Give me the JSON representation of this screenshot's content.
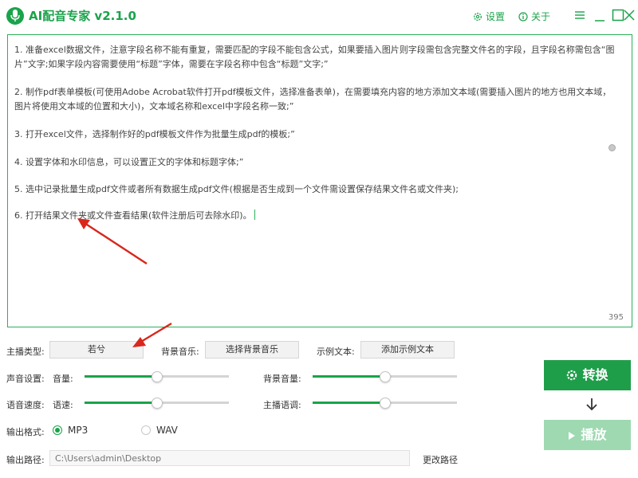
{
  "app": {
    "title": "AI配音专家 v2.1.0",
    "settings_label": "设置",
    "about_label": "关于"
  },
  "editor": {
    "lines": [
      "1. 准备excel数据文件，注意字段名称不能有重复，需要匹配的字段不能包含公式，如果要插入图片则字段需包含完整文件名的字段，且字段名称需包含“图",
      "片”文字;如果字段内容需要使用“标题”字体，需要在字段名称中包含“标题”文字;”",
      "2. 制作pdf表单模板(可使用Adobe Acrobat软件打开pdf模板文件，选择准备表单)，在需要填充内容的地方添加文本域(需要插入图片的地方也用文本域，",
      "图片将使用文本域的位置和大小)，文本域名称和excel中字段名称一致;”",
      "3. 打开excel文件，选择制作好的pdf模板文件作为批量生成pdf的模板;”",
      "4. 设置字体和水印信息，可以设置正文的字体和标题字体;”",
      "5. 选中记录批量生成pdf文件或者所有数据生成pdf文件(根据是否生成到一个文件需设置保存结果文件名或文件夹);",
      "6. 打开结果文件夹或文件查看结果(软件注册后可去除水印)。"
    ],
    "char_count": "395"
  },
  "settings": {
    "anchor_type_label": "主播类型:",
    "anchor_type_value": "若兮",
    "bg_music_label": "背景音乐:",
    "bg_music_button": "选择背景音乐",
    "sample_text_label": "示例文本:",
    "sample_text_button": "添加示例文本",
    "sound_settings_label": "声音设置:",
    "volume_label": "音量:",
    "volume_level": 0.5,
    "bg_volume_label": "背景音量:",
    "bg_volume_level": 0.5,
    "speech_speed_label": "语音速度:",
    "speed_label": "语速:",
    "speed_level": 0.5,
    "tone_label": "主播语调:",
    "tone_level": 0.5,
    "output_format_label": "输出格式:",
    "format_options": [
      "MP3",
      "WAV"
    ],
    "format_selected": "MP3",
    "output_path_label": "输出路径:",
    "output_path_placeholder": "C:\\Users\\admin\\Desktop",
    "change_path_label": "更改路径"
  },
  "actions": {
    "convert_label": "转换",
    "play_label": "播放"
  },
  "colors": {
    "accent": "#1aa34a",
    "convert_bg": "#1f9e4a",
    "play_bg": "#9ed9b2",
    "annotation_arrow": "#d9261c"
  }
}
